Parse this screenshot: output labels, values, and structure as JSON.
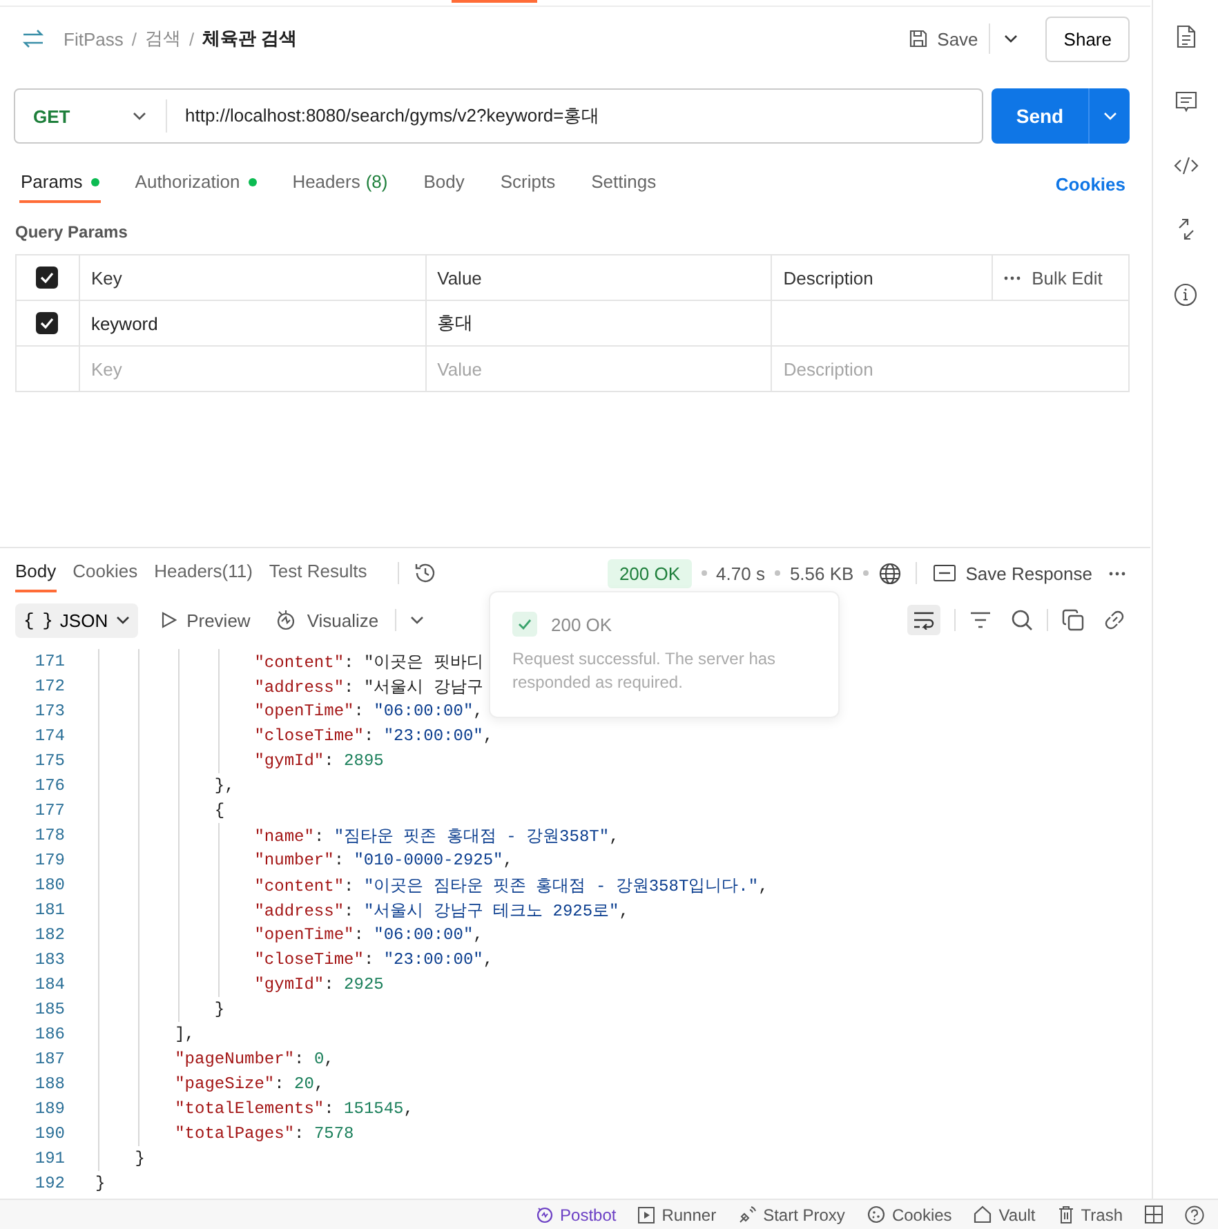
{
  "breadcrumb": [
    "FitPass",
    "검색",
    "체육관 검색"
  ],
  "breadcrumb_separator": "/",
  "header": {
    "save": "Save",
    "share": "Share"
  },
  "request": {
    "method": "GET",
    "url": "http://localhost:8080/search/gyms/v2?keyword=홍대",
    "send": "Send"
  },
  "request_tabs": [
    {
      "label": "Params",
      "indicator": true,
      "selected": true
    },
    {
      "label": "Authorization",
      "indicator": true,
      "selected": false
    },
    {
      "label": "Headers",
      "count": "(8)",
      "indicator": false,
      "selected": false
    },
    {
      "label": "Body",
      "indicator": false,
      "selected": false
    },
    {
      "label": "Scripts",
      "indicator": false,
      "selected": false
    },
    {
      "label": "Settings",
      "indicator": false,
      "selected": false
    }
  ],
  "cookies_link": "Cookies",
  "query_params": {
    "title": "Query Params",
    "all_checked": true,
    "columns": [
      "Key",
      "Value",
      "Description"
    ],
    "bulk_edit": "Bulk Edit",
    "rows": [
      {
        "checked": true,
        "key": "keyword",
        "value": "홍대"
      }
    ],
    "placeholders": {
      "key": "Key",
      "value": "Value",
      "description": "Description"
    }
  },
  "response_tabs": [
    {
      "label": "Body",
      "selected": true
    },
    {
      "label": "Cookies",
      "selected": false
    },
    {
      "label": "Headers",
      "count": "(11)",
      "selected": false
    },
    {
      "label": "Test Results",
      "selected": false
    }
  ],
  "response_meta": {
    "status": "200 OK",
    "time": "4.70 s",
    "size": "5.56 KB",
    "save_response": "Save Response"
  },
  "body_toolbar": {
    "format_icon": "{ }",
    "format": "JSON",
    "preview": "Preview",
    "visualize": "Visualize"
  },
  "toast": {
    "title": "200 OK",
    "message": "Request successful. The server has responded as required."
  },
  "code_lines": [
    {
      "num": "171",
      "text": "                \"content\": \"이곳은 핏바디"
    },
    {
      "num": "172",
      "text": "                \"address\": \"서울시 강남구"
    },
    {
      "num": "173",
      "text": "                \"openTime\": \"06:00:00\","
    },
    {
      "num": "174",
      "text": "                \"closeTime\": \"23:00:00\","
    },
    {
      "num": "175",
      "text": "                \"gymId\": 2895"
    },
    {
      "num": "176",
      "text": "            },"
    },
    {
      "num": "177",
      "text": "            {"
    },
    {
      "num": "178",
      "text": "                \"name\": \"짐타운 핏존 홍대점 - 강원358T\","
    },
    {
      "num": "179",
      "text": "                \"number\": \"010-0000-2925\","
    },
    {
      "num": "180",
      "text": "                \"content\": \"이곳은 짐타운 핏존 홍대점 - 강원358T입니다.\","
    },
    {
      "num": "181",
      "text": "                \"address\": \"서울시 강남구 테크노 2925로\","
    },
    {
      "num": "182",
      "text": "                \"openTime\": \"06:00:00\","
    },
    {
      "num": "183",
      "text": "                \"closeTime\": \"23:00:00\","
    },
    {
      "num": "184",
      "text": "                \"gymId\": 2925"
    },
    {
      "num": "185",
      "text": "            }"
    },
    {
      "num": "186",
      "text": "        ],"
    },
    {
      "num": "187",
      "text": "        \"pageNumber\": 0,"
    },
    {
      "num": "188",
      "text": "        \"pageSize\": 20,"
    },
    {
      "num": "189",
      "text": "        \"totalElements\": 151545,"
    },
    {
      "num": "190",
      "text": "        \"totalPages\": 7578"
    },
    {
      "num": "191",
      "text": "    }"
    },
    {
      "num": "192",
      "text": "}"
    }
  ],
  "footer": [
    {
      "kind": "postbot",
      "label": "Postbot"
    },
    {
      "kind": "runner",
      "label": "Runner"
    },
    {
      "kind": "proxy",
      "label": "Start Proxy"
    },
    {
      "kind": "cookies",
      "label": "Cookies"
    },
    {
      "kind": "vault",
      "label": "Vault"
    },
    {
      "kind": "trash",
      "label": "Trash"
    }
  ]
}
